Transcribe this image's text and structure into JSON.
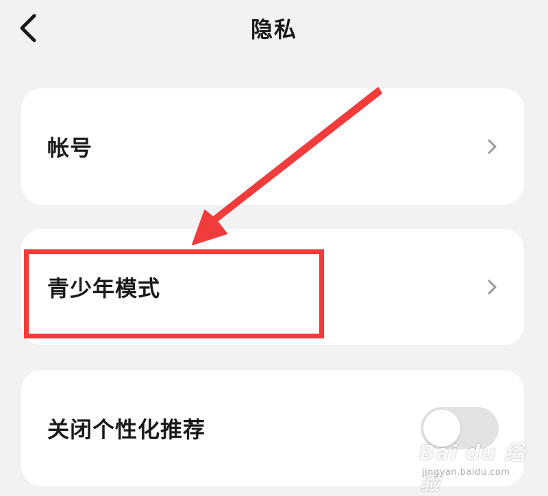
{
  "header": {
    "title": "隐私",
    "back_icon": "chevron-left-icon"
  },
  "items": [
    {
      "label": "帐号",
      "type": "link",
      "trailing_icon": "chevron-right-icon"
    },
    {
      "label": "青少年模式",
      "type": "link",
      "trailing_icon": "chevron-right-icon",
      "highlighted": true
    },
    {
      "label": "关闭个性化推荐",
      "type": "toggle",
      "toggle_on": false
    }
  ],
  "annotation": {
    "color": "#f23b3b",
    "arrow_icon": "arrow-icon"
  },
  "watermark": {
    "logo_text": "Bai du 经验",
    "url": "jingyan.baidu.com"
  },
  "colors": {
    "background": "#f2f2f2",
    "card": "#ffffff",
    "text": "#1a1a1a",
    "chevron": "#9a9a9a",
    "toggle_track_off": "#e3e3e3"
  }
}
